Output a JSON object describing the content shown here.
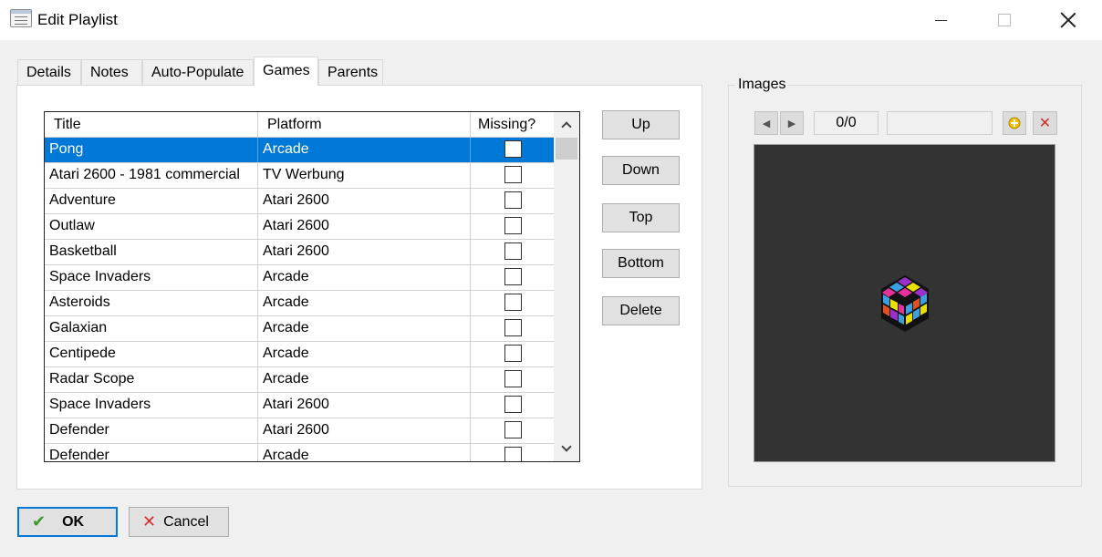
{
  "window": {
    "title": "Edit Playlist"
  },
  "tabs": [
    "Details",
    "Notes",
    "Auto-Populate",
    "Games",
    "Parents"
  ],
  "active_tab": "Games",
  "grid": {
    "columns": [
      "Title",
      "Platform",
      "Missing?"
    ],
    "rows": [
      {
        "title": "Pong",
        "platform": "Arcade",
        "missing": false,
        "selected": true
      },
      {
        "title": "Atari 2600 - 1981 commercial",
        "platform": "TV Werbung",
        "missing": false
      },
      {
        "title": "Adventure",
        "platform": "Atari 2600",
        "missing": false
      },
      {
        "title": "Outlaw",
        "platform": "Atari 2600",
        "missing": false
      },
      {
        "title": "Basketball",
        "platform": "Atari 2600",
        "missing": false
      },
      {
        "title": "Space Invaders",
        "platform": "Arcade",
        "missing": false
      },
      {
        "title": "Asteroids",
        "platform": "Arcade",
        "missing": false
      },
      {
        "title": "Galaxian",
        "platform": "Arcade",
        "missing": false
      },
      {
        "title": "Centipede",
        "platform": "Arcade",
        "missing": false
      },
      {
        "title": "Radar Scope",
        "platform": "Arcade",
        "missing": false
      },
      {
        "title": "Space Invaders",
        "platform": "Atari 2600",
        "missing": false
      },
      {
        "title": "Defender",
        "platform": "Atari 2600",
        "missing": false
      },
      {
        "title": "Defender",
        "platform": "Arcade",
        "missing": false
      }
    ]
  },
  "order_buttons": {
    "up": "Up",
    "down": "Down",
    "top": "Top",
    "bottom": "Bottom",
    "delete": "Delete"
  },
  "images": {
    "label": "Images",
    "counter": "0/0",
    "prev_icon": "triangle-left-icon",
    "next_icon": "triangle-right-icon",
    "add_icon": "add-image-icon",
    "remove_icon": "close-icon",
    "placeholder_icon": "colorful-cube-icon"
  },
  "footer": {
    "ok": "OK",
    "cancel": "Cancel"
  },
  "colors": {
    "selection": "#0078d7",
    "preview_bg": "#333333"
  }
}
